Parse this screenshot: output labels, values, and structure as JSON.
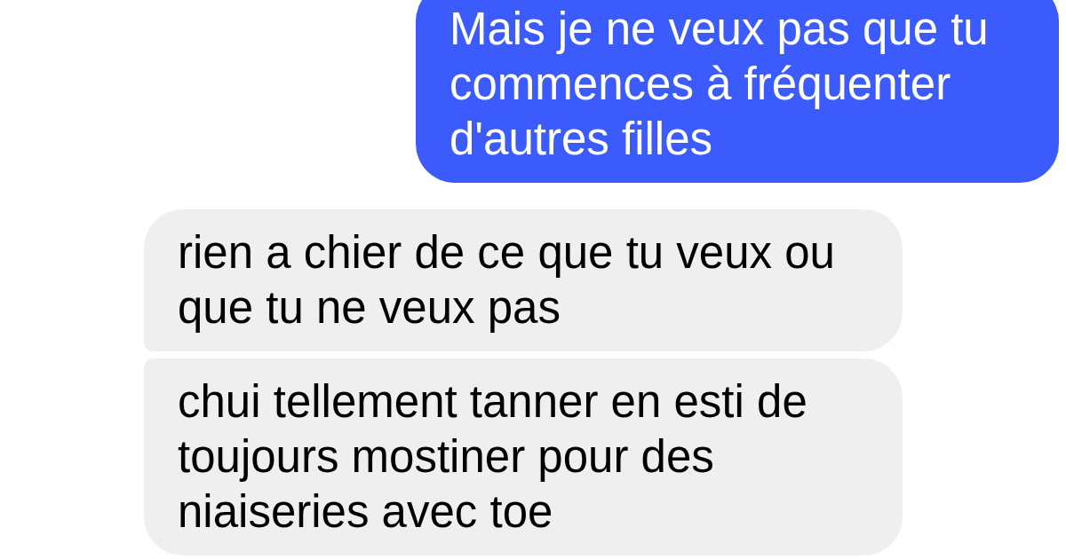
{
  "messages": [
    {
      "kind": "sent",
      "text": "Mais je ne veux pas que tu commences à fréquenter d'autres filles"
    },
    {
      "kind": "received",
      "text": "rien a chier de ce que tu veux ou que tu ne veux pas"
    },
    {
      "kind": "received",
      "text": "chui tellement tanner en esti de toujours mostiner pour des niaiseries avec toe"
    }
  ]
}
